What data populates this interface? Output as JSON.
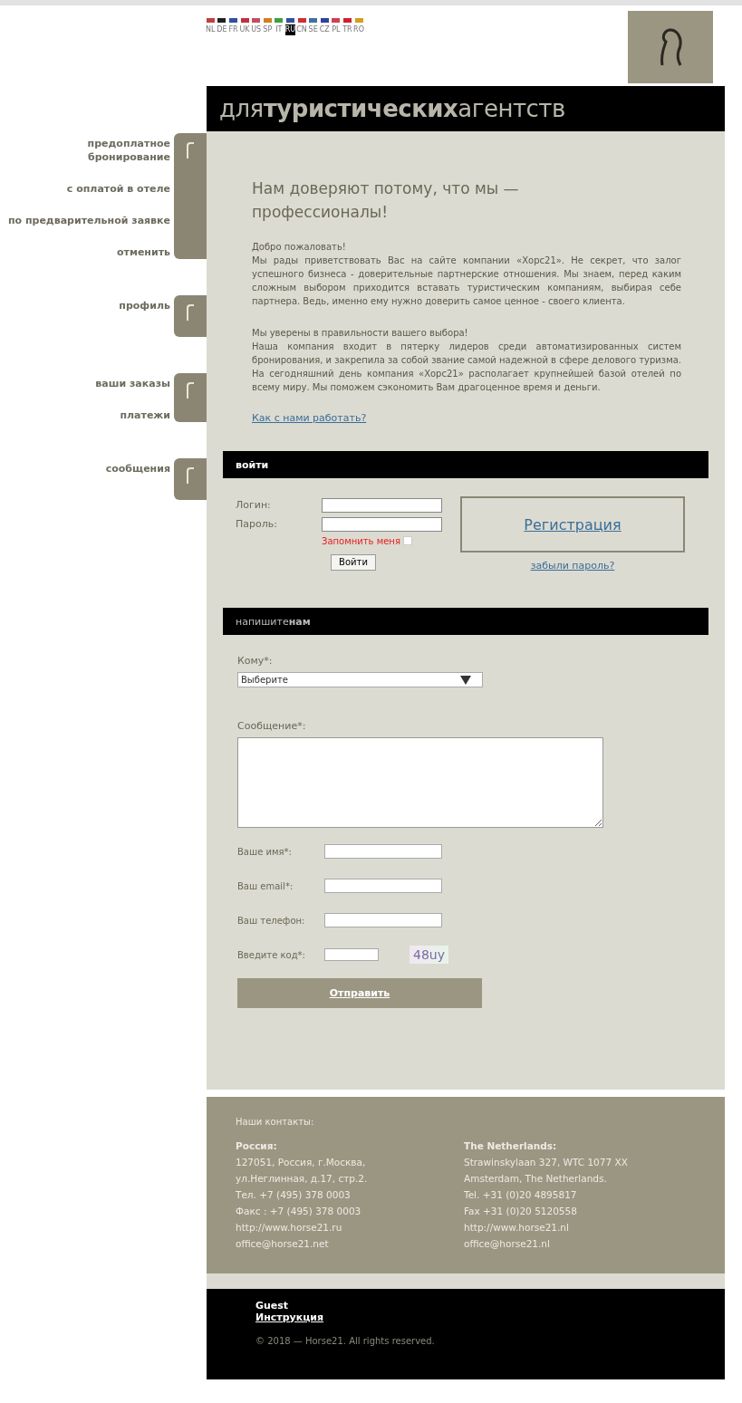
{
  "languages": [
    {
      "code": "NL",
      "color": "#c04040",
      "selected": false
    },
    {
      "code": "DE",
      "color": "#202020",
      "selected": false
    },
    {
      "code": "FR",
      "color": "#3050a0",
      "selected": false
    },
    {
      "code": "UK",
      "color": "#c03040",
      "selected": false
    },
    {
      "code": "US",
      "color": "#c05060",
      "selected": false
    },
    {
      "code": "SP",
      "color": "#d08020",
      "selected": false
    },
    {
      "code": "IT",
      "color": "#40a040",
      "selected": false
    },
    {
      "code": "RU",
      "color": "#3050a0",
      "selected": true
    },
    {
      "code": "CN",
      "color": "#d03030",
      "selected": false
    },
    {
      "code": "SE",
      "color": "#4070a0",
      "selected": false
    },
    {
      "code": "CZ",
      "color": "#3040a0",
      "selected": false
    },
    {
      "code": "PL",
      "color": "#d04050",
      "selected": false
    },
    {
      "code": "TR",
      "color": "#d02030",
      "selected": false
    },
    {
      "code": "RO",
      "color": "#d0a020",
      "selected": false
    }
  ],
  "header_title": "для**туристических**агентств",
  "sidebar": {
    "groups": [
      {
        "items": [
          "предоплатное бронирование",
          "с оплатой в отеле",
          "по предварительной заявке",
          "отменить"
        ]
      },
      {
        "items": [
          "профиль"
        ]
      },
      {
        "items": [
          "ваши заказы",
          "платежи"
        ]
      },
      {
        "items": [
          "сообщения"
        ]
      }
    ]
  },
  "intro": {
    "heading": "Нам доверяют потому, что мы — профессионалы!",
    "paragraphs": [
      [
        "Добро пожаловать!",
        "Мы рады приветствовать Вас на сайте компании «Хорс21». Не секрет, что залог успешного бизнеса - доверительные партнерские отношения. Мы знаем, перед каким сложным выбором приходится вставать туристическим компаниям, выбирая себе партнера. Ведь, именно ему нужно доверить самое ценное - своего клиента."
      ],
      [
        "Мы уверены в правильности вашего выбора!",
        "Наша компания входит в пятерку лидеров среди автоматизированных систем бронирования, и закрепила за собой звание самой надежной в сфере делового туризма. На сегодняшний день компания «Хорс21» располагает крупнейшей базой отелей по всему миру. Мы поможем сэкономить Вам драгоценное время и деньги."
      ]
    ],
    "link": "Как с нами работать?"
  },
  "login": {
    "title": "войти",
    "login_label": "Логин:",
    "password_label": "Пароль:",
    "remember": {
      "label": "Запомнить меня",
      "checked": false
    },
    "submit": "Войти",
    "register": "Регистрация",
    "forgot": "забыли пароль?"
  },
  "contact": {
    "title": "напишите**нам**",
    "to_label": "Кому*:",
    "to_value": "Выберите",
    "message_label": "Сообщение*:",
    "name_label": "Ваше имя*:",
    "email_label": "Ваш email*:",
    "phone_label": "Ваш телефон:",
    "code_label": "Введите код*:",
    "captcha": "48uy",
    "submit": "Отправить"
  },
  "footer": {
    "title": "Наши контакты:",
    "columns": [
      {
        "heading": "Россия:",
        "lines": [
          "127051, Россия, г.Москва,",
          "ул.Неглинная, д.17, стр.2.",
          "Тел. +7 (495) 378 0003",
          "Факс : +7 (495) 378 0003",
          "http://www.horse21.ru",
          "office@horse21.net"
        ]
      },
      {
        "heading": "The Netherlands:",
        "lines": [
          "Strawinskylaan 327, WTC 1077 XX",
          "Amsterdam, The Netherlands.",
          "Tel. +31 (0)20 4895817",
          "Fax +31 (0)20 5120558",
          "http://www.horse21.nl",
          "office@horse21.nl"
        ]
      }
    ]
  },
  "bottom": {
    "user": "Guest",
    "instructions": "Инструкция",
    "copyright": "© 2018 — Horse21. All rights reserved."
  }
}
